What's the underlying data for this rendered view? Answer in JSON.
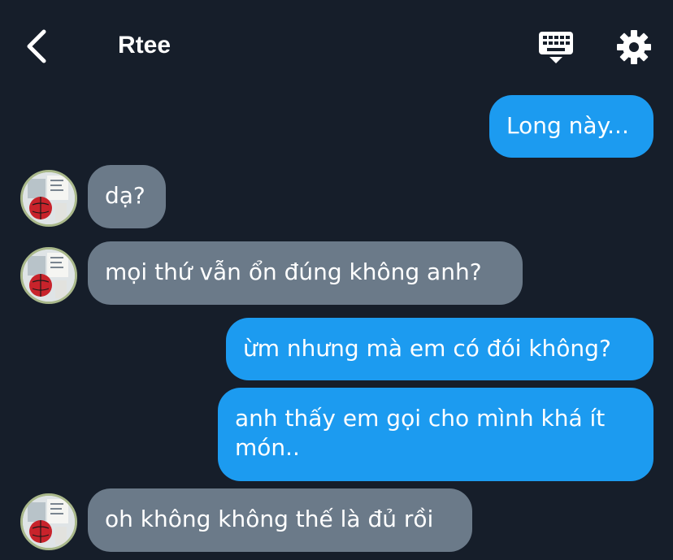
{
  "header": {
    "title": "Rtee",
    "back_icon": "chevron-left-icon",
    "keyboard_icon": "keyboard-icon",
    "settings_icon": "gear-icon"
  },
  "messages": [
    {
      "from": "me",
      "text": "Long này..."
    },
    {
      "from": "Rtee",
      "text": "dạ?"
    },
    {
      "from": "Rtee",
      "text": "mọi thứ vẫn ổn đúng không anh?"
    },
    {
      "from": "me",
      "text": "ừm nhưng mà em có đói không?"
    },
    {
      "from": "me",
      "text": "anh thấy em gọi cho mình khá ít món.."
    },
    {
      "from": "Rtee",
      "text": "oh không không thế là đủ rồi"
    }
  ],
  "colors": {
    "background": "#161e2a",
    "outgoing_bubble": "#1c9bf0",
    "incoming_bubble": "#6b7a89",
    "text": "#ffffff"
  }
}
